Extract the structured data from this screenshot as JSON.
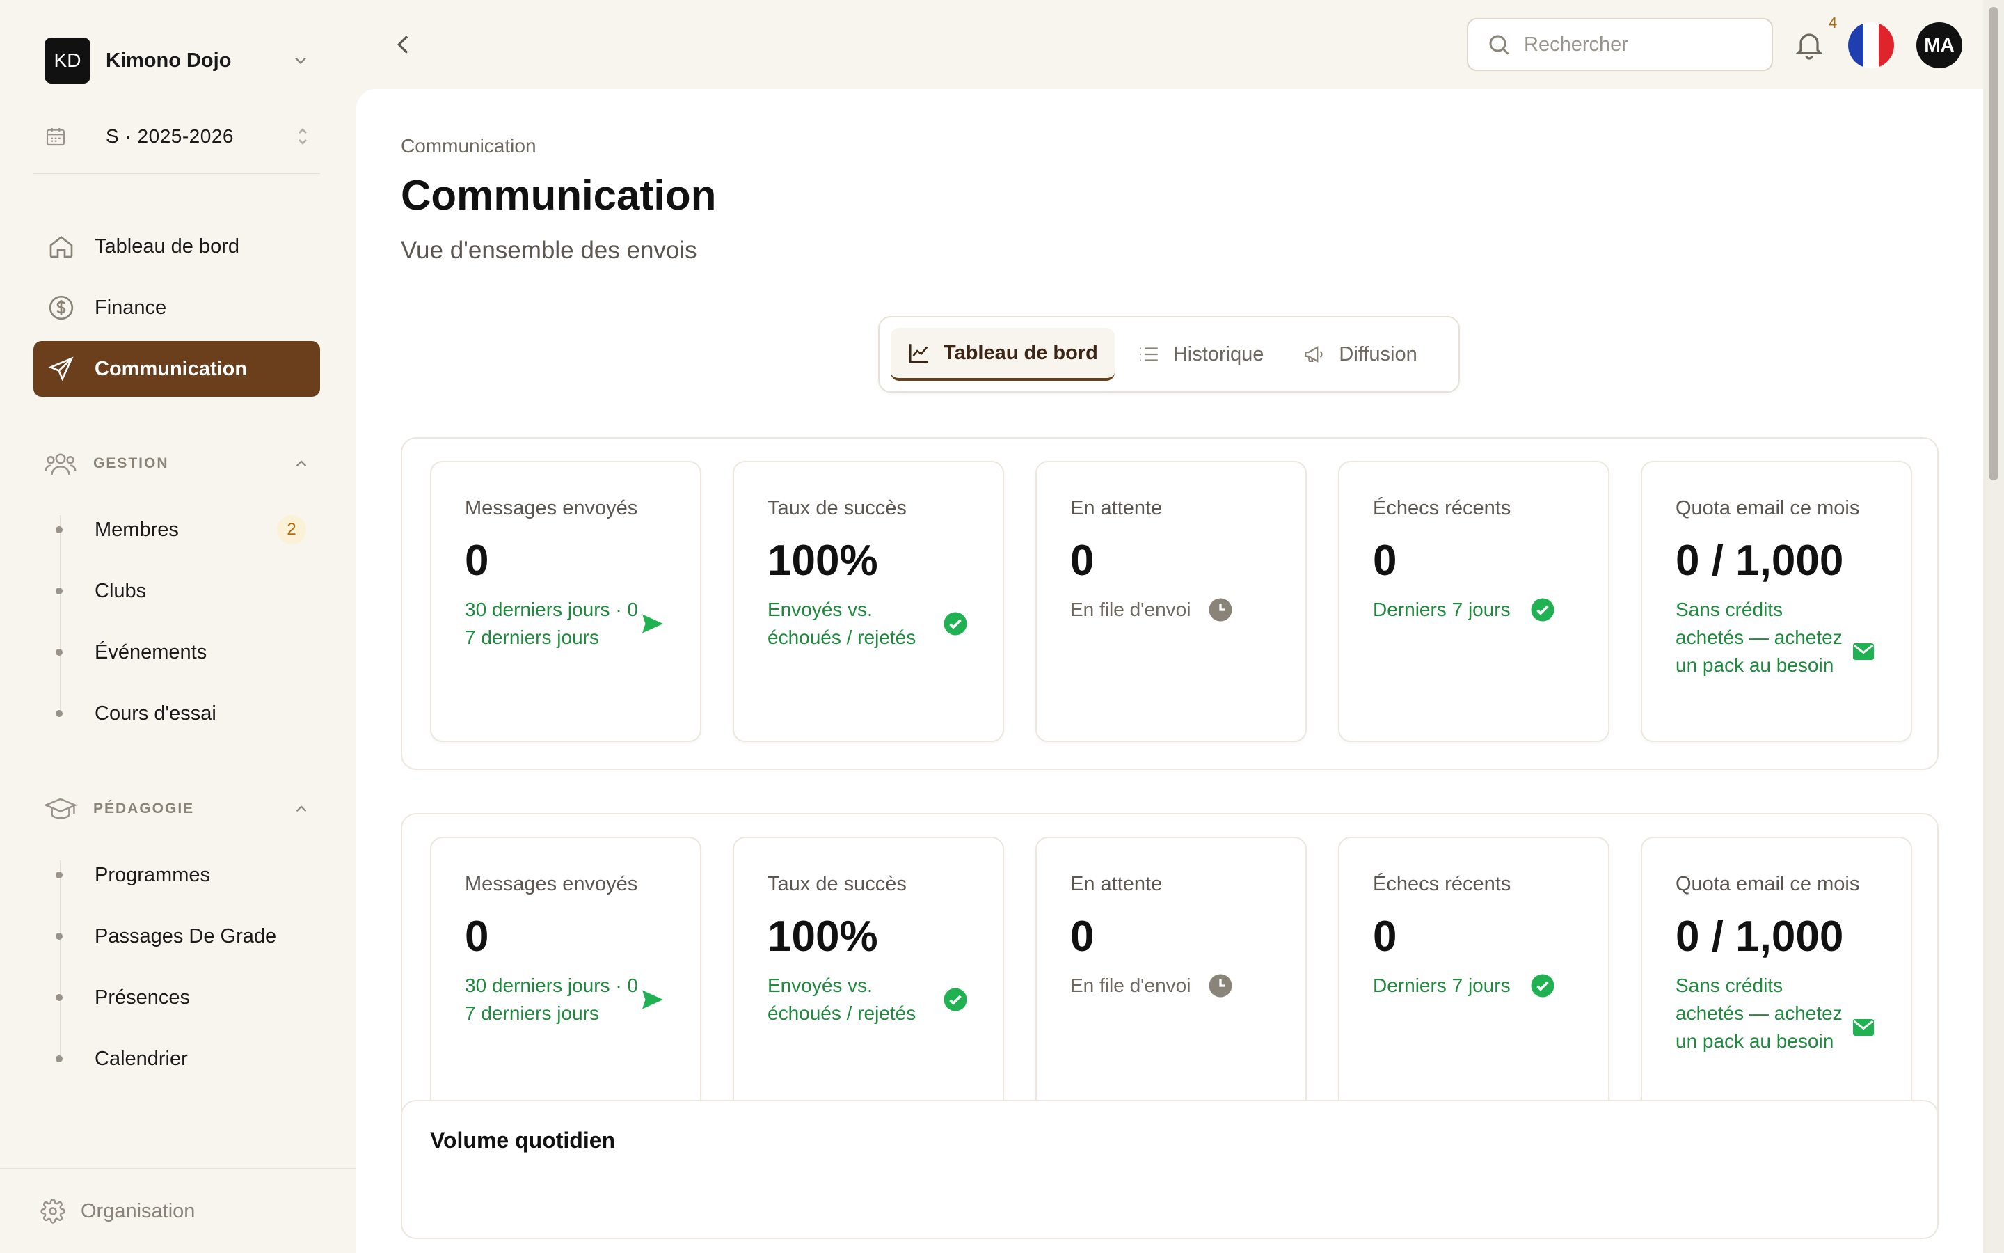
{
  "org": {
    "initials": "KD",
    "name": "Kimono Dojo"
  },
  "season": {
    "label": "S · 2025-2026"
  },
  "nav": {
    "dashboard": "Tableau de bord",
    "finance": "Finance",
    "communication": "Communication"
  },
  "sections": {
    "gestion": {
      "title": "GESTION",
      "items": [
        "Membres",
        "Clubs",
        "Événements",
        "Cours d'essai"
      ],
      "members_badge": "2"
    },
    "pedagogie": {
      "title": "PÉDAGOGIE",
      "items": [
        "Programmes",
        "Passages De Grade",
        "Présences",
        "Calendrier"
      ]
    }
  },
  "footer": {
    "organisation": "Organisation"
  },
  "topbar": {
    "search_placeholder": "Rechercher",
    "notifications_count": "4",
    "avatar_initials": "MA"
  },
  "page": {
    "breadcrumb": "Communication",
    "title": "Communication",
    "subtitle": "Vue d'ensemble des envois"
  },
  "tabs": [
    {
      "label": "Tableau de bord",
      "active": true
    },
    {
      "label": "Historique",
      "active": false
    },
    {
      "label": "Diffusion",
      "active": false
    }
  ],
  "stats": [
    {
      "title": "Messages envoyés",
      "value": "0",
      "note": "30 derniers jours · 0 7 derniers jours",
      "icon": "send-icon"
    },
    {
      "title": "Taux de succès",
      "value": "100%",
      "note": "Envoyés vs. échoués / rejetés",
      "icon": "check-circle-icon"
    },
    {
      "title": "En attente",
      "value": "0",
      "note": "En file d'envoi",
      "icon": "clock-icon"
    },
    {
      "title": "Échecs récents",
      "value": "0",
      "note": "Derniers 7 jours",
      "icon": "check-circle-icon"
    },
    {
      "title": "Quota email ce mois",
      "value": "0 / 1,000",
      "note": "Sans crédits achetés — achetez un pack au besoin",
      "icon": "mail-icon"
    }
  ],
  "volume": {
    "title": "Volume quotidien"
  },
  "colors": {
    "accent": "#6b3e1c",
    "success": "#1f8a3e",
    "background": "#f8f5ef"
  }
}
